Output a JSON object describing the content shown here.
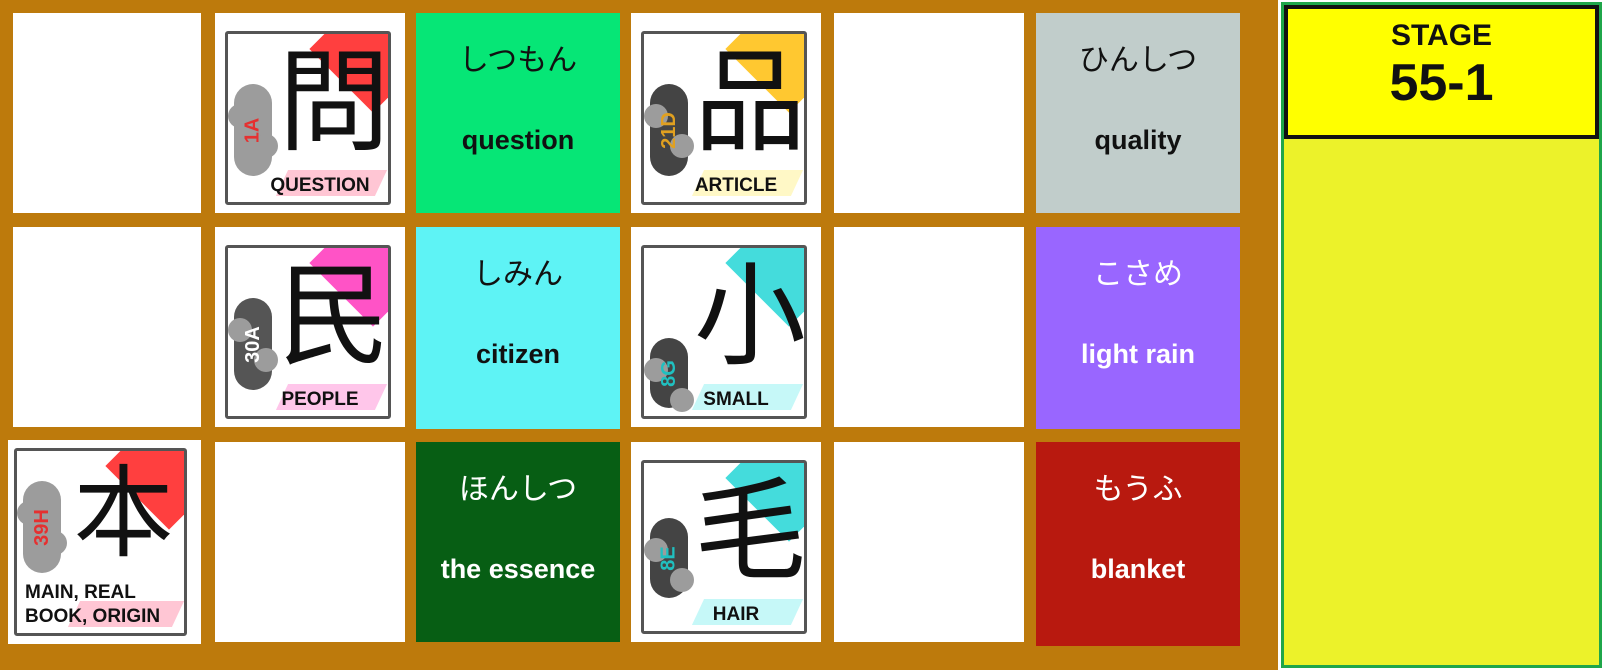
{
  "stage": {
    "title": "STAGE",
    "number": "55-1"
  },
  "kanji_cards": [
    {
      "kanji": "問",
      "code": "1A",
      "label": "QUESTION",
      "code_color": "#e53030",
      "accent": "#ff2a2a"
    },
    {
      "kanji": "品",
      "code": "21D",
      "label": "ARTICLE",
      "code_color": "#e0a020",
      "accent": "#ffc21a"
    },
    {
      "kanji": "民",
      "code": "30A",
      "label": "PEOPLE",
      "code_color": "#ffffff",
      "accent": "#ff40c0"
    },
    {
      "kanji": "小",
      "code": "8G",
      "label": "SMALL",
      "code_color": "#20c0c0",
      "accent": "#30d8d8"
    },
    {
      "kanji": "本",
      "code": "39H",
      "label": "MAIN, REAL BOOK, ORIGIN",
      "code_color": "#e53030",
      "accent": "#ff2a2a"
    },
    {
      "kanji": "毛",
      "code": "8E",
      "label": "HAIR",
      "code_color": "#20c0c0",
      "accent": "#30d8d8"
    }
  ],
  "vocab_cards": [
    {
      "kana": "しつもん",
      "meaning": "question",
      "bg": "#06e676",
      "text_color": "#111111"
    },
    {
      "kana": "ひんしつ",
      "meaning": "quality",
      "bg": "#c1cdcb",
      "text_color": "#111111"
    },
    {
      "kana": "しみん",
      "meaning": "citizen",
      "bg": "#5ef3f5",
      "text_color": "#111111"
    },
    {
      "kana": "こさめ",
      "meaning": "light rain",
      "bg": "#9966ff",
      "text_color": "#ffffff"
    },
    {
      "kana": "ほんしつ",
      "meaning": "the essence",
      "bg": "#075e14",
      "text_color": "#ffffff"
    },
    {
      "kana": "もうふ",
      "meaning": "blanket",
      "bg": "#b8190f",
      "text_color": "#ffffff"
    }
  ]
}
